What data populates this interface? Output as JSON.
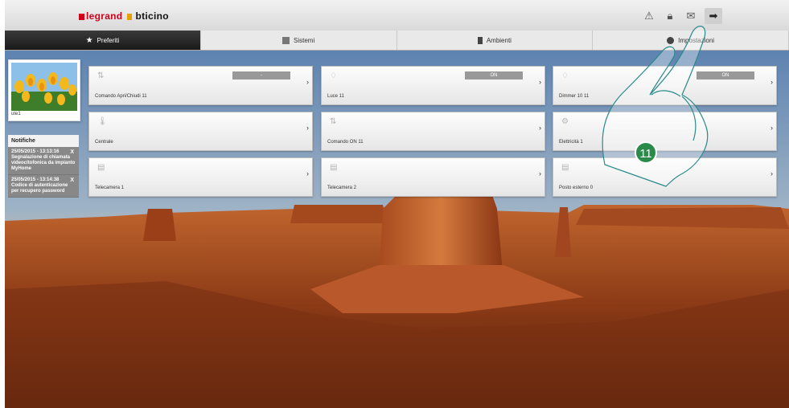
{
  "brand": {
    "legrand": "legrand",
    "bticino": "bticino"
  },
  "toolbar": {
    "icons": [
      "warning-icon",
      "lock-icon",
      "mail-icon",
      "logout-icon"
    ]
  },
  "tabs": [
    {
      "label": "Preferiti",
      "icon": "star-icon",
      "active": true
    },
    {
      "label": "Sistemi",
      "icon": "systems-icon",
      "active": false
    },
    {
      "label": "Ambienti",
      "icon": "rooms-icon",
      "active": false
    },
    {
      "label": "Impostazioni",
      "icon": "settings-icon",
      "active": false
    }
  ],
  "user": {
    "name": "ute1"
  },
  "notifications": {
    "title": "Notifiche",
    "close": "X",
    "items": [
      {
        "text": "25/05/2015 - 13:13:16 Segnalazione di chiamata videocitofonica da impianto MyHome"
      },
      {
        "text": "25/05/2015 - 13:14:38 Codice di autenticazione per recupero password"
      }
    ]
  },
  "cards": [
    {
      "label": "Comando Apri/Chiudi 11",
      "icon": "shutter-icon",
      "state": "-"
    },
    {
      "label": "Luce 11",
      "icon": "light-icon",
      "state": "ON"
    },
    {
      "label": "Dimmer 10 11",
      "icon": "light-icon",
      "state": "ON"
    },
    {
      "label": "Centrale",
      "icon": "thermometer-icon",
      "state": ""
    },
    {
      "label": "Comando ON 11",
      "icon": "shutter-icon",
      "state": ""
    },
    {
      "label": "Elettricità 1",
      "icon": "energy-icon",
      "state": ""
    },
    {
      "label": "Telecamera 1",
      "icon": "camera-icon",
      "state": ""
    },
    {
      "label": "Telecamera 2",
      "icon": "camera-icon",
      "state": ""
    },
    {
      "label": "Posto esterno 0",
      "icon": "camera-icon",
      "state": ""
    }
  ],
  "card_arrow": "›",
  "callout": "11",
  "colors": {
    "brand_red": "#d0021b",
    "callout_green": "#2a8a4a"
  }
}
